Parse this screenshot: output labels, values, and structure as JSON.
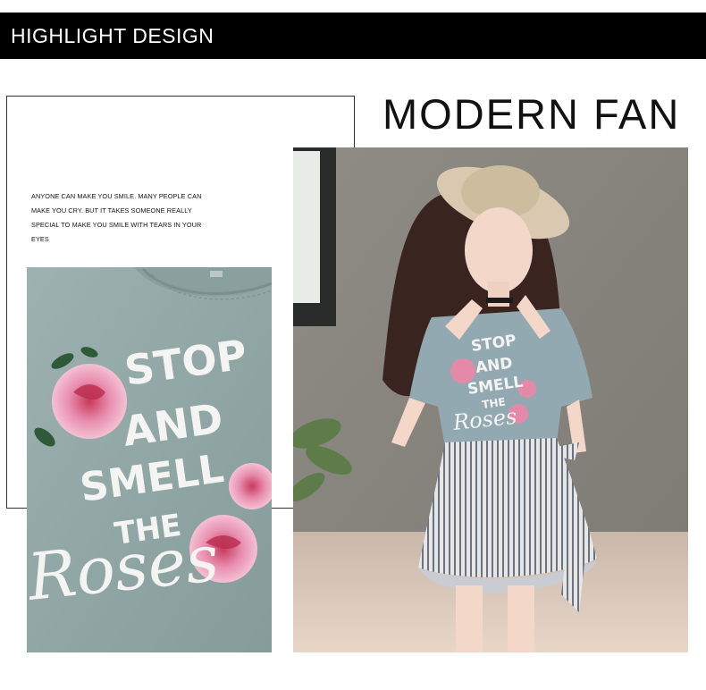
{
  "banner": {
    "title": "HIGHLIGHT DESIGN"
  },
  "headline": "MODERN FAN",
  "quote": {
    "lines": [
      "ANYONE CAN MAKE YOU SMILE. MANY PEOPLE CAN",
      "MAKE YOU CRY. BUT IT TAKES SOMEONE REALLY",
      "SPECIAL TO MAKE YOU SMILE WITH TEARS IN YOUR",
      "EYES"
    ]
  },
  "closeup_print": {
    "lines": [
      "STOP",
      "AND",
      "SMELL",
      "THE",
      "Roses"
    ]
  },
  "model_print": {
    "lines": [
      "STOP",
      "AND",
      "SMELL",
      "THE",
      "Roses"
    ]
  },
  "colors": {
    "banner_bg": "#000000",
    "banner_text": "#ffffff",
    "fabric": "#93a8a6",
    "rose": "#e48aa8",
    "wall": "#8a8780"
  }
}
